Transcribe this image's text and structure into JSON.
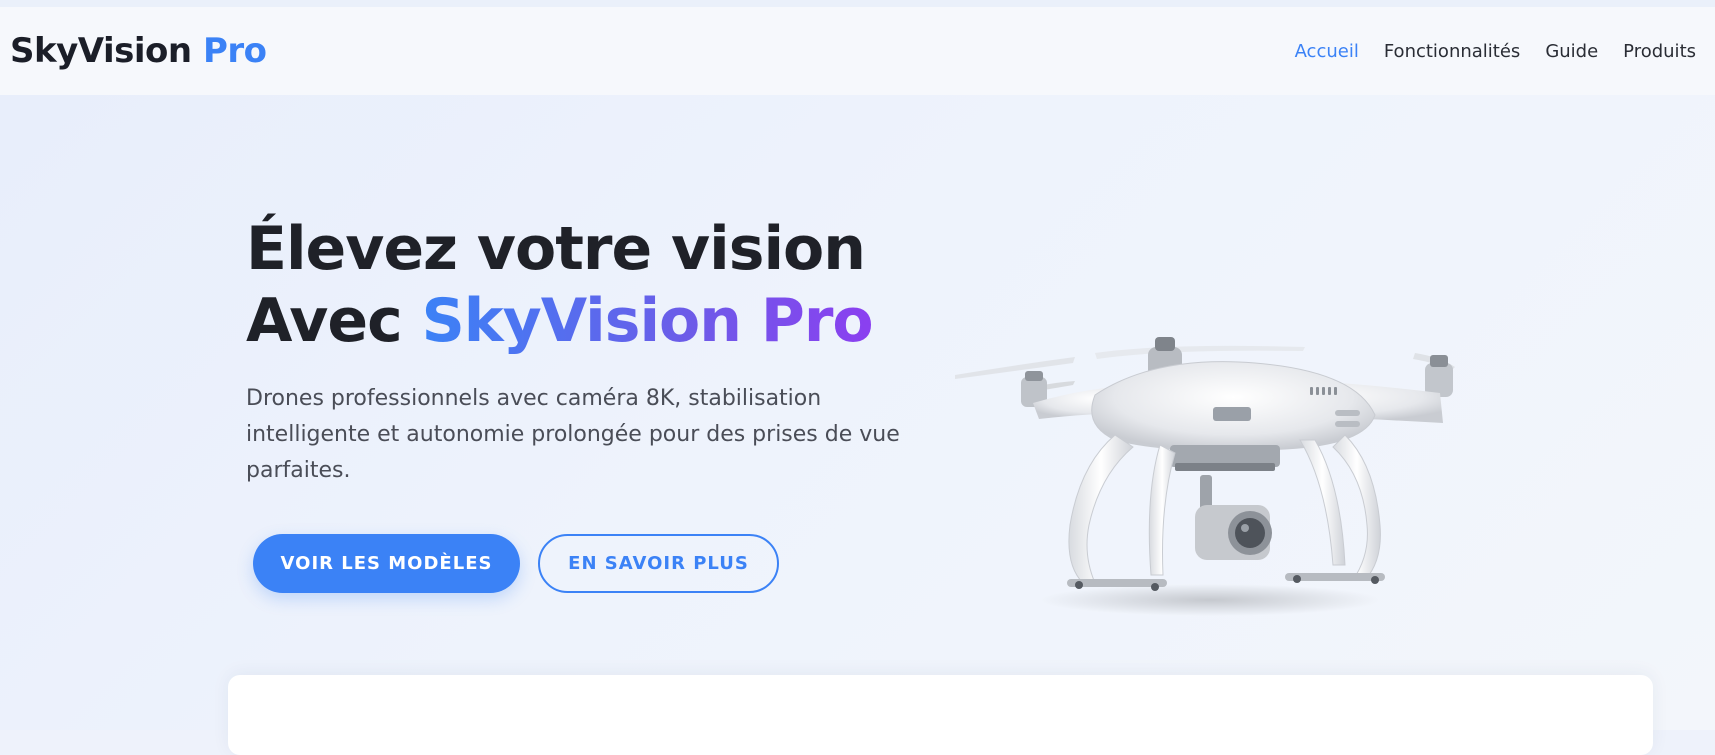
{
  "brand": {
    "name": "SkyVision",
    "accent": "Pro"
  },
  "nav": {
    "items": [
      {
        "label": "Accueil",
        "active": true
      },
      {
        "label": "Fonctionnalités",
        "active": false
      },
      {
        "label": "Guide",
        "active": false
      },
      {
        "label": "Produits",
        "active": false
      }
    ]
  },
  "hero": {
    "title_line1": "Élevez votre vision",
    "title_line2_prefix": "Avec",
    "title_line2_highlight": "SkyVision Pro",
    "description": "Drones professionnels avec caméra 8K, stabilisation intelligente et autonomie prolongée pour des prises de vue parfaites.",
    "primary_button": "VOIR LES MODÈLES",
    "secondary_button": "EN SAVOIR PLUS",
    "image": "drone-quadcopter"
  },
  "colors": {
    "accent": "#3b82f6",
    "gradient_end": "#8b3ff0",
    "text_dark": "#1f2128",
    "text_body": "#4a4d57"
  }
}
